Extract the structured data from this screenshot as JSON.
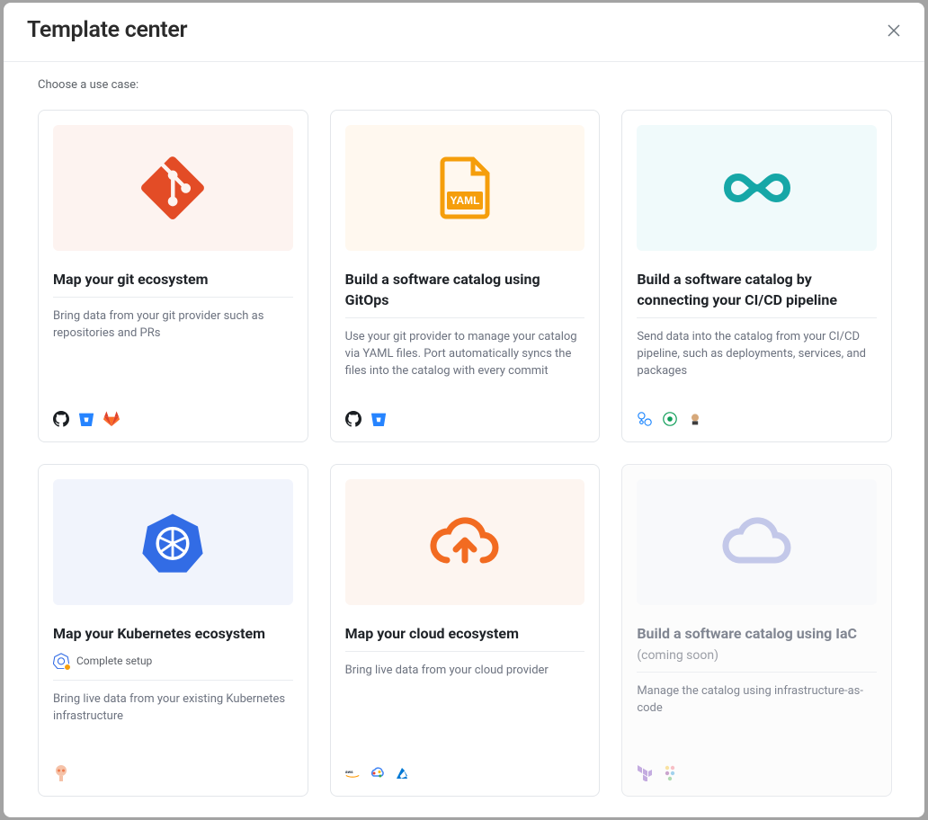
{
  "modal": {
    "title": "Template center",
    "subtitle": "Choose a use case:"
  },
  "cards": [
    {
      "title": "Map your git ecosystem",
      "description": "Bring data from your git provider such as repositories and PRs",
      "hero_class": "hero-git",
      "disabled": false
    },
    {
      "title": "Build a software catalog using GitOps",
      "description": "Use your git provider to manage your catalog via YAML files. Port automatically syncs the files into the catalog with every commit",
      "hero_class": "hero-yaml",
      "disabled": false
    },
    {
      "title": "Build a software catalog by connecting your CI/CD pipeline",
      "description": "Send data into the catalog from your CI/CD pipeline, such as deployments, services, and packages",
      "hero_class": "hero-cicd",
      "disabled": false
    },
    {
      "title": "Map your Kubernetes ecosystem",
      "description": "Bring live data from your existing Kubernetes infrastructure",
      "hero_class": "hero-k8s",
      "disabled": false,
      "status_text": "Complete setup"
    },
    {
      "title": "Map your cloud ecosystem",
      "description": "Bring live data from your cloud provider",
      "hero_class": "hero-cloud",
      "disabled": false
    },
    {
      "title": "Build a software catalog using IaC",
      "coming_soon": "(coming soon)",
      "description": "Manage the catalog using infrastructure-as-code",
      "hero_class": "hero-iac",
      "disabled": true
    }
  ]
}
